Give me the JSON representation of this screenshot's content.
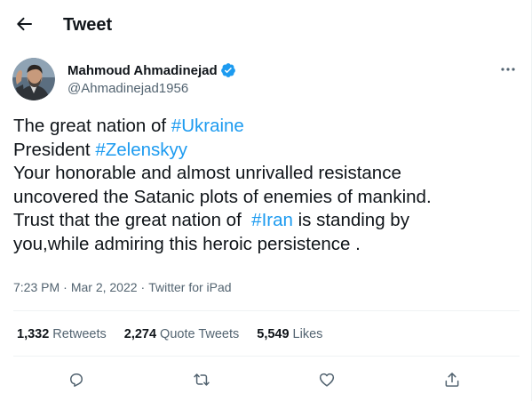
{
  "header": {
    "title": "Tweet"
  },
  "author": {
    "name": "Mahmoud Ahmadinejad",
    "handle": "@Ahmadinejad1956",
    "verified": true
  },
  "tweet": {
    "lines": [
      [
        "The great nation of ",
        "#Ukraine"
      ],
      [
        "President ",
        "#Zelenskyy"
      ],
      [
        "Your honorable and almost unrivalled resistance"
      ],
      [
        "uncovered the Satanic plots of enemies of mankind."
      ],
      [
        "Trust that the great nation of  ",
        "#Iran",
        " is standing by"
      ],
      [
        "you,while admiring this heroic persistence ."
      ]
    ],
    "time": "7:23 PM",
    "date": "Mar 2, 2022",
    "separator": "·",
    "source": "Twitter for iPad"
  },
  "stats": {
    "retweets_count": "1,332",
    "retweets_label": "Retweets",
    "quotes_count": "2,274",
    "quotes_label": "Quote Tweets",
    "likes_count": "5,549",
    "likes_label": "Likes"
  },
  "colors": {
    "accent": "#1d9bf0",
    "text": "#0f1419",
    "secondary": "#536471",
    "divider": "#eff3f4"
  },
  "icons": {
    "back": "arrow-left-icon",
    "verified": "verified-badge-icon",
    "more": "more-horizontal-icon",
    "reply": "reply-icon",
    "retweet": "retweet-icon",
    "like": "heart-icon",
    "share": "share-icon"
  }
}
